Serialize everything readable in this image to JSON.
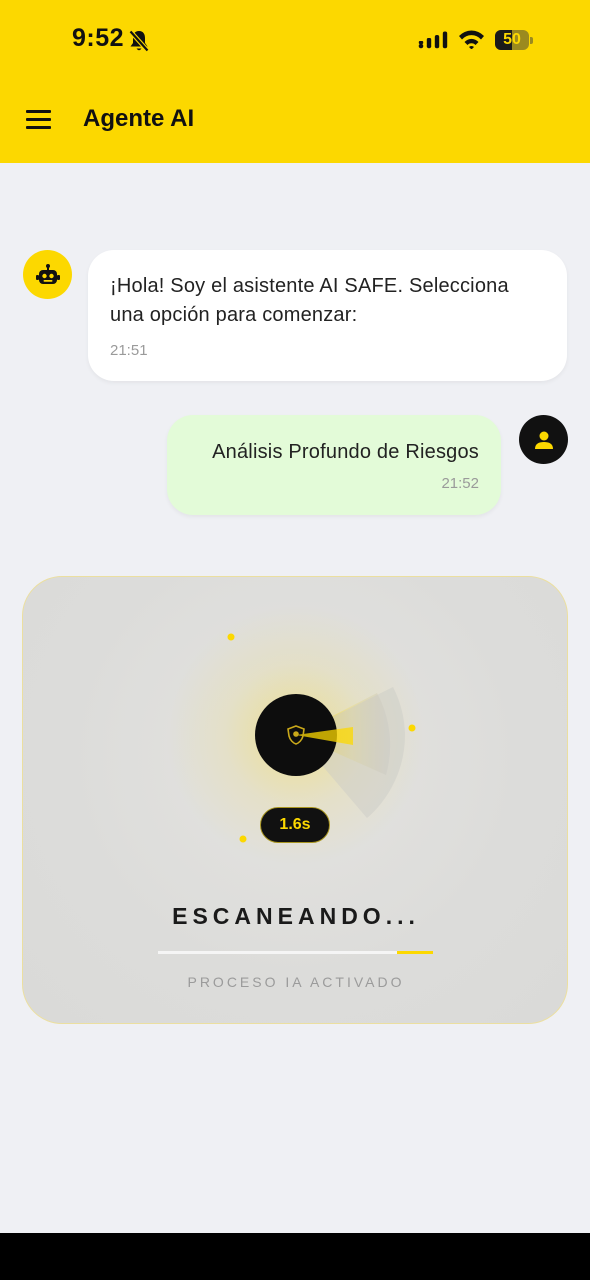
{
  "status_bar": {
    "time": "9:52",
    "battery": "50",
    "battery_level": 0.5
  },
  "app_bar": {
    "title": "Agente AI",
    "menu_icon": "hamburger-menu-icon"
  },
  "messages": [
    {
      "sender": "bot",
      "avatar_icon": "robot-icon",
      "text": "¡Hola! Soy el asistente AI SAFE. Selecciona una opción para comenzar:",
      "time": "21:51"
    },
    {
      "sender": "user",
      "avatar_icon": "person-icon",
      "text": "Análisis Profundo de Riesgos",
      "time": "21:52"
    }
  ],
  "scanner": {
    "timer": "1.6s",
    "title": "ESCANEANDO...",
    "progress": 0.13,
    "subtitle": "PROCESO IA ACTIVADO",
    "center_icon": "shield-logo-icon"
  },
  "colors": {
    "accent": "#fcd800",
    "dark": "#111111",
    "background": "#eff0f4",
    "user_bubble": "#e3fbd8",
    "bot_bubble": "#ffffff"
  }
}
